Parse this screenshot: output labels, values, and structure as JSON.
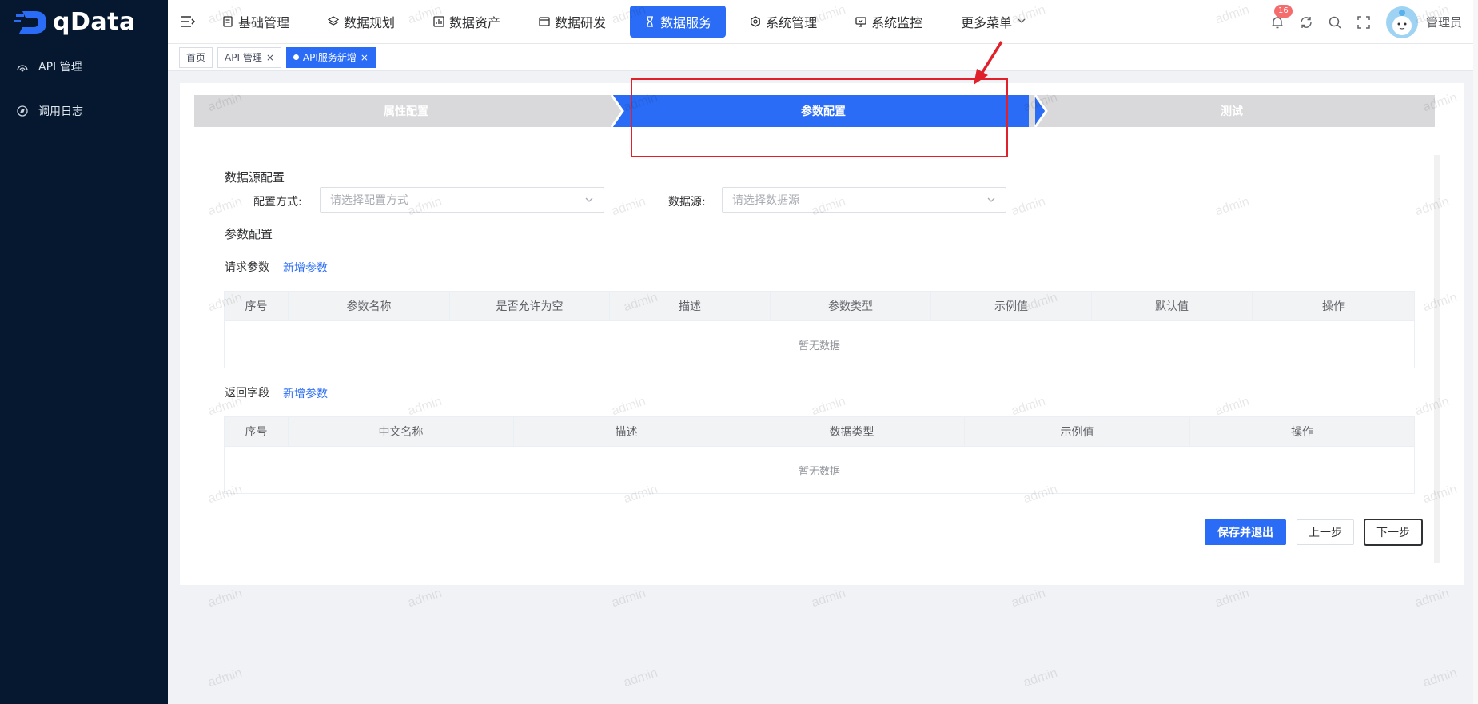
{
  "app": {
    "name": "qData"
  },
  "sidebar": {
    "items": [
      {
        "label": "API 管理"
      },
      {
        "label": "调用日志"
      }
    ]
  },
  "topnav": {
    "items": [
      {
        "label": "基础管理"
      },
      {
        "label": "数据规划"
      },
      {
        "label": "数据资产"
      },
      {
        "label": "数据研发"
      },
      {
        "label": "数据服务",
        "active": true
      },
      {
        "label": "系统管理"
      },
      {
        "label": "系统监控"
      }
    ],
    "more_label": "更多菜单",
    "notification_count": "16",
    "user_name": "管理员"
  },
  "tabs": [
    {
      "label": "首页"
    },
    {
      "label": "API 管理"
    },
    {
      "label": "API服务新增",
      "active": true
    }
  ],
  "steps": [
    {
      "label": "属性配置"
    },
    {
      "label": "参数配置",
      "active": true
    },
    {
      "label": "测试"
    }
  ],
  "datasource": {
    "section_title": "数据源配置",
    "config_label": "配置方式:",
    "config_placeholder": "请选择配置方式",
    "source_label": "数据源:",
    "source_placeholder": "请选择数据源"
  },
  "params": {
    "section_title": "参数配置",
    "request": {
      "title": "请求参数",
      "add_label": "新增参数",
      "columns": [
        "序号",
        "参数名称",
        "是否允许为空",
        "描述",
        "参数类型",
        "示例值",
        "默认值",
        "操作"
      ],
      "empty_text": "暂无数据"
    },
    "response": {
      "title": "返回字段",
      "add_label": "新增参数",
      "columns": [
        "序号",
        "中文名称",
        "描述",
        "数据类型",
        "示例值",
        "操作"
      ],
      "empty_text": "暂无数据"
    }
  },
  "actions": {
    "save_exit": "保存并退出",
    "prev": "上一步",
    "next": "下一步"
  },
  "watermark": "admin",
  "colors": {
    "primary": "#2a6cf6",
    "sidebar_bg": "#06182f",
    "annotation": "#e0202a"
  }
}
